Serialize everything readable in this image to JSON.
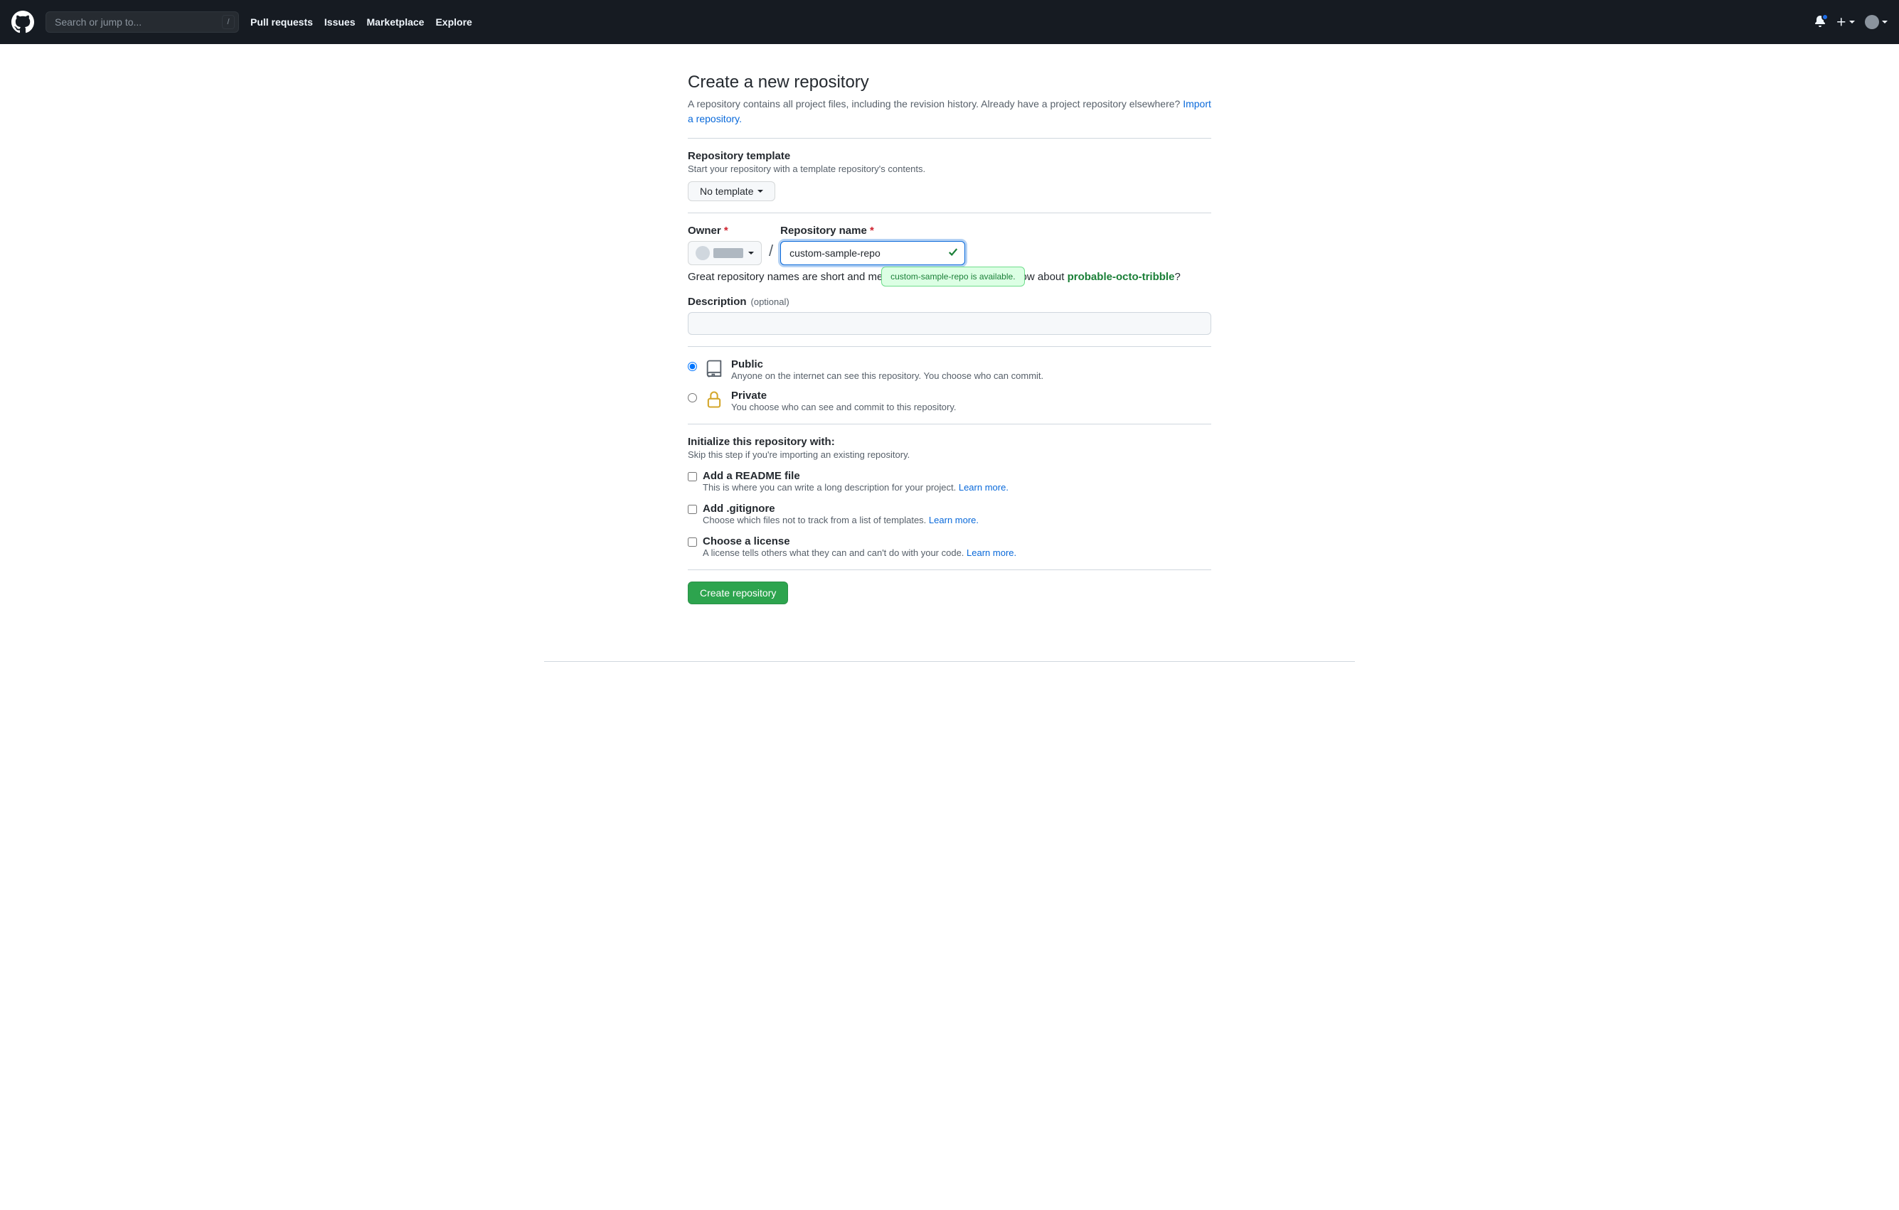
{
  "header": {
    "search_placeholder": "Search or jump to...",
    "slash": "/",
    "nav": {
      "pull_requests": "Pull requests",
      "issues": "Issues",
      "marketplace": "Marketplace",
      "explore": "Explore"
    }
  },
  "page": {
    "title": "Create a new repository",
    "subtitle_pre": "A repository contains all project files, including the revision history. Already have a project repository elsewhere? ",
    "import_link": "Import a repository."
  },
  "template": {
    "label": "Repository template",
    "sub": "Start your repository with a template repository's contents.",
    "button": "No template"
  },
  "owner_label": "Owner",
  "repo_name_label": "Repository name",
  "repo_name_value": "custom-sample-repo",
  "availability_tooltip": "custom-sample-repo is available.",
  "inspire": {
    "pre": "Great repository names are short and memorable. Need inspiration? How about ",
    "suggestion": "probable-octo-tribble",
    "post": "?"
  },
  "description": {
    "label": "Description",
    "optional": "(optional)",
    "value": ""
  },
  "visibility": {
    "public": {
      "title": "Public",
      "desc": "Anyone on the internet can see this repository. You choose who can commit."
    },
    "private": {
      "title": "Private",
      "desc": "You choose who can see and commit to this repository."
    }
  },
  "initialize": {
    "heading": "Initialize this repository with:",
    "sub": "Skip this step if you're importing an existing repository.",
    "readme": {
      "title": "Add a README file",
      "desc": "This is where you can write a long description for your project. ",
      "link": "Learn more."
    },
    "gitignore": {
      "title": "Add .gitignore",
      "desc": "Choose which files not to track from a list of templates. ",
      "link": "Learn more."
    },
    "license": {
      "title": "Choose a license",
      "desc": "A license tells others what they can and can't do with your code. ",
      "link": "Learn more."
    }
  },
  "create_button": "Create repository"
}
